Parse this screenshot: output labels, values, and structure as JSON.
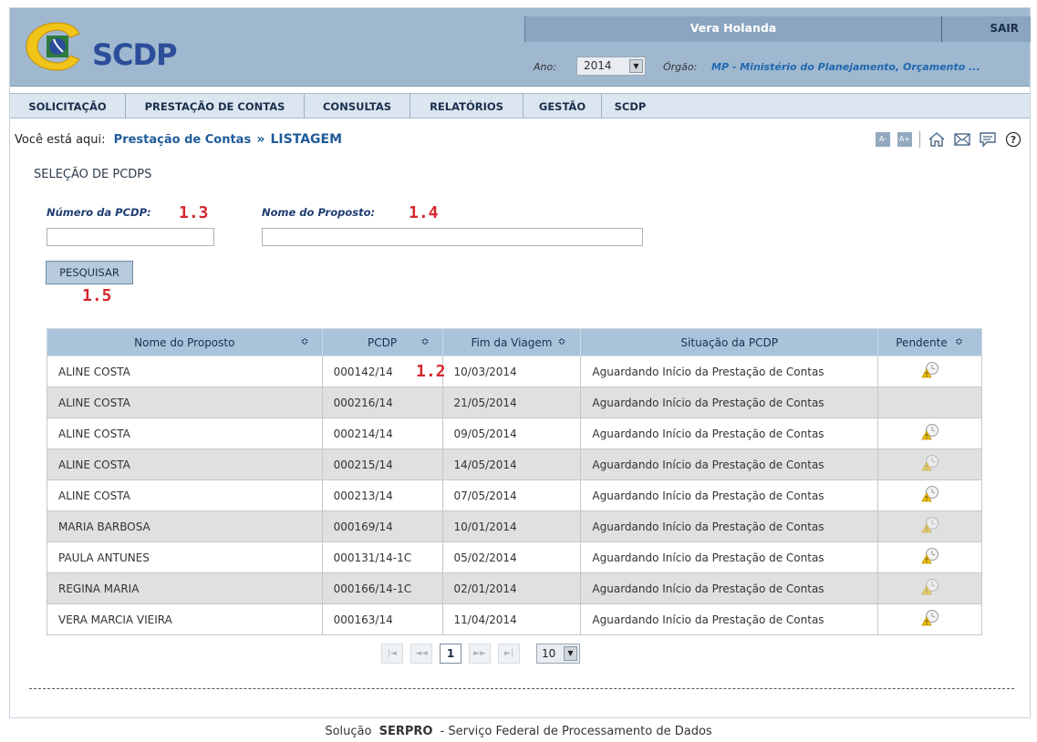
{
  "header": {
    "logo_text": "SCDP",
    "user_name": "Vera Holanda",
    "logout_label": "SAIR",
    "ano_label": "Ano:",
    "ano_value": "2014",
    "orgao_label": "Órgão:",
    "orgao_value": "MP - Ministério do Planejamento, Orçamento ..."
  },
  "menu": [
    "SOLICITAÇÃO",
    "PRESTAÇÃO DE CONTAS",
    "CONSULTAS",
    "RELATÓRIOS",
    "GESTÃO",
    "SCDP"
  ],
  "breadcrumb": {
    "prefix": "Você está aqui:",
    "link": "Prestação de Contas",
    "separator": "»",
    "current": "LISTAGEM"
  },
  "toolbar": {
    "font_decrease": "A-",
    "font_increase": "A+",
    "icons": [
      "home-icon",
      "mail-icon",
      "chat-icon",
      "help-icon"
    ]
  },
  "search": {
    "section_title": "SELEÇÃO DE PCDPS",
    "numero_label": "Número da PCDP:",
    "numero_value": "",
    "nome_label": "Nome do Proposto:",
    "nome_value": "",
    "button_label": "PESQUISAR"
  },
  "annotations": {
    "numero": "1.3",
    "nome": "1.4",
    "button": "1.5",
    "pcdp_column": "1.2"
  },
  "table": {
    "columns": [
      "Nome do Proposto",
      "PCDP",
      "Fim da Viagem",
      "Situação da PCDP",
      "Pendente"
    ],
    "rows": [
      {
        "nome": "ALINE COSTA",
        "pcdp": "000142/14",
        "fim": "10/03/2014",
        "situacao": "Aguardando Início da Prestação de Contas",
        "pendente": true
      },
      {
        "nome": "ALINE COSTA",
        "pcdp": "000216/14",
        "fim": "21/05/2014",
        "situacao": "Aguardando Início da Prestação de Contas",
        "pendente": false
      },
      {
        "nome": "ALINE COSTA",
        "pcdp": "000214/14",
        "fim": "09/05/2014",
        "situacao": "Aguardando Início da Prestação de Contas",
        "pendente": true
      },
      {
        "nome": "ALINE COSTA",
        "pcdp": "000215/14",
        "fim": "14/05/2014",
        "situacao": "Aguardando Início da Prestação de Contas",
        "pendente": true
      },
      {
        "nome": "ALINE COSTA",
        "pcdp": "000213/14",
        "fim": "07/05/2014",
        "situacao": "Aguardando Início da Prestação de Contas",
        "pendente": true
      },
      {
        "nome": "MARIA BARBOSA",
        "pcdp": "000169/14",
        "fim": "10/01/2014",
        "situacao": "Aguardando Início da Prestação de Contas",
        "pendente": true
      },
      {
        "nome": "PAULA ANTUNES",
        "pcdp": "000131/14-1C",
        "fim": "05/02/2014",
        "situacao": "Aguardando Início da Prestação de Contas",
        "pendente": true
      },
      {
        "nome": "REGINA MARIA",
        "pcdp": "000166/14-1C",
        "fim": "02/01/2014",
        "situacao": "Aguardando Início da Prestação de Contas",
        "pendente": true
      },
      {
        "nome": "VERA MARCIA VIEIRA",
        "pcdp": "000163/14",
        "fim": "11/04/2014",
        "situacao": "Aguardando Início da Prestação de Contas",
        "pendente": true
      }
    ]
  },
  "pagination": {
    "first": "|◄",
    "prev": "◄◄",
    "current_page": "1",
    "next": "►►",
    "last": "►|",
    "page_size": "10"
  },
  "footer": {
    "prefix": "Solução",
    "brand": "SERPRO",
    "suffix": "- Serviço Federal de Processamento de Dados"
  },
  "colors": {
    "header_bg": "#9fb8cf",
    "menu_bg": "#dbe6f0",
    "link": "#1f5b9a",
    "annotation": "#d6262d",
    "row_alt": "#e0e0e0"
  }
}
